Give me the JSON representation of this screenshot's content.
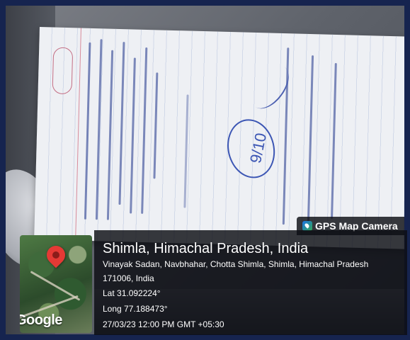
{
  "overlay": {
    "app_name": "GPS Map Camera",
    "app_icon": "gps-map-camera-icon",
    "location_title": "Shimla, Himachal Pradesh, India",
    "address_line1": "Vinayak Sadan, Navbhahar, Chotta Shimla, Shimla, Himachal Pradesh",
    "address_line2": "171006, India",
    "latitude": "Lat 31.092224°",
    "longitude": "Long 77.188473°",
    "timestamp": "27/03/23 12:00 PM GMT +05:30",
    "map_brand": "Google",
    "pin_color": "#e53935"
  }
}
